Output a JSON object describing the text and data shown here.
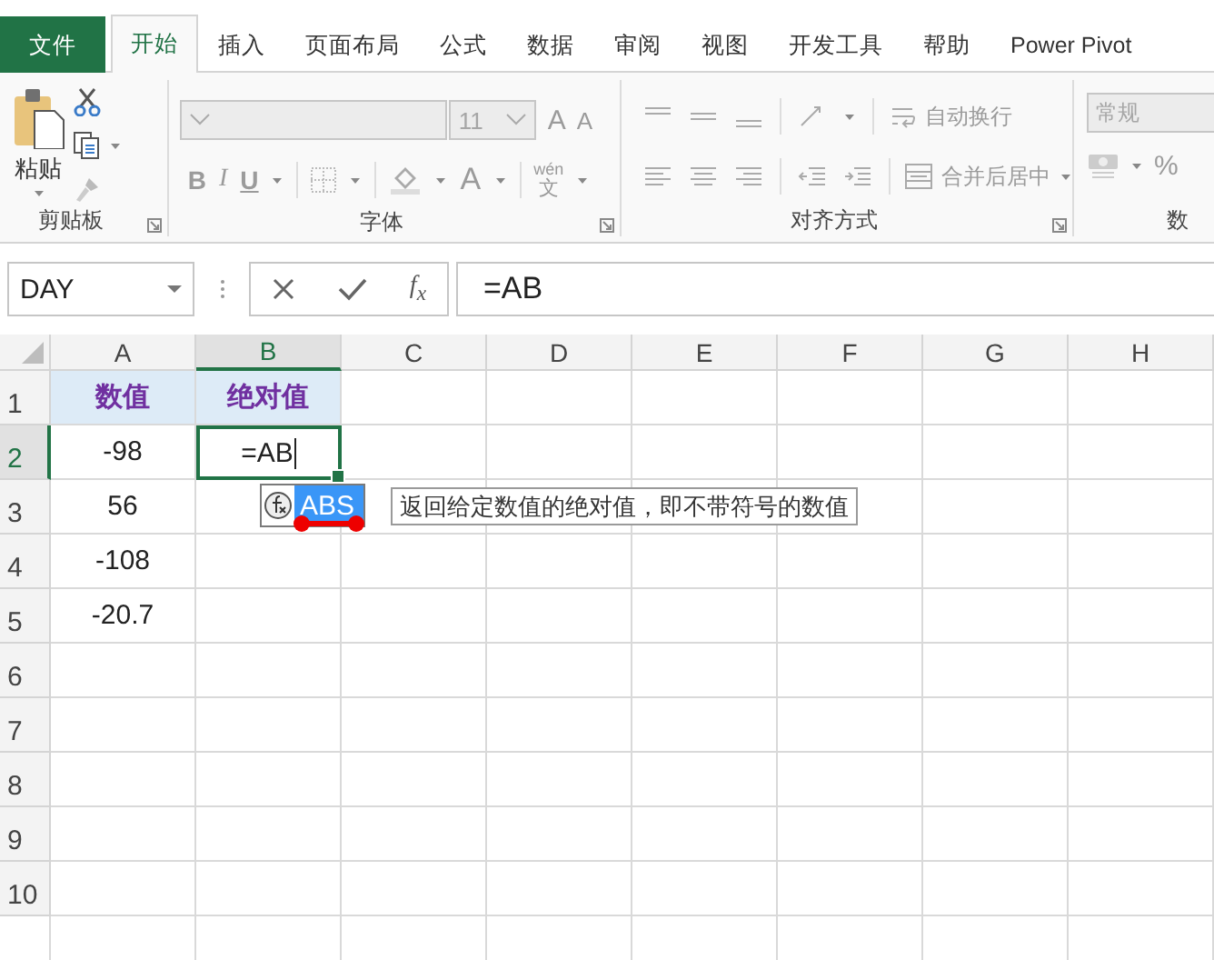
{
  "ribbon_tabs": [
    {
      "label": "文件",
      "kind": "file",
      "selected": false
    },
    {
      "label": "开始",
      "kind": "tab",
      "selected": true
    },
    {
      "label": "插入",
      "kind": "tab",
      "selected": false
    },
    {
      "label": "页面布局",
      "kind": "tab",
      "selected": false
    },
    {
      "label": "公式",
      "kind": "tab",
      "selected": false
    },
    {
      "label": "数据",
      "kind": "tab",
      "selected": false
    },
    {
      "label": "审阅",
      "kind": "tab",
      "selected": false
    },
    {
      "label": "视图",
      "kind": "tab",
      "selected": false
    },
    {
      "label": "开发工具",
      "kind": "tab",
      "selected": false
    },
    {
      "label": "帮助",
      "kind": "tab",
      "selected": false
    },
    {
      "label": "Power Pivot",
      "kind": "tab",
      "selected": false
    }
  ],
  "ribbon": {
    "clipboard": {
      "paste_label": "粘贴",
      "group_label": "剪贴板"
    },
    "font": {
      "font_size": "11",
      "grow_label": "A",
      "shrink_label": "A",
      "bold_label": "B",
      "italic_label": "I",
      "underline_label": "U",
      "font_color_label": "A",
      "phonetic_top": "wén",
      "phonetic_bottom": "文",
      "group_label": "字体"
    },
    "alignment": {
      "wrap_text": "自动换行",
      "merge_center": "合并后居中",
      "group_label": "对齐方式"
    },
    "number": {
      "format": "常规",
      "percent": "%",
      "group_label": "数"
    }
  },
  "formula_bar": {
    "name_box": "DAY",
    "function_label": "f$_{x}$",
    "formula": "=AB"
  },
  "sheet": {
    "columns": [
      {
        "label": "A",
        "selected": false
      },
      {
        "label": "B",
        "selected": true
      },
      {
        "label": "C",
        "selected": false
      },
      {
        "label": "D",
        "selected": false
      },
      {
        "label": "E",
        "selected": false
      },
      {
        "label": "F",
        "selected": false
      },
      {
        "label": "G",
        "selected": false
      },
      {
        "label": "H",
        "selected": false
      }
    ],
    "rows": [
      {
        "label": "1",
        "selected": false,
        "kind": "header",
        "cells": [
          {
            "text": "数值",
            "editing": false
          },
          {
            "text": "绝对值",
            "editing": false
          }
        ]
      },
      {
        "label": "2",
        "selected": true,
        "kind": "data",
        "cells": [
          {
            "text": "-98",
            "editing": false
          },
          {
            "text": "=AB",
            "editing": true
          }
        ]
      },
      {
        "label": "3",
        "selected": false,
        "kind": "data",
        "cells": [
          {
            "text": "56",
            "editing": false
          }
        ]
      },
      {
        "label": "4",
        "selected": false,
        "kind": "data",
        "cells": [
          {
            "text": "-108",
            "editing": false
          }
        ]
      },
      {
        "label": "5",
        "selected": false,
        "kind": "data",
        "cells": [
          {
            "text": "-20.7",
            "editing": false
          }
        ]
      },
      {
        "label": "6",
        "selected": false,
        "kind": "data",
        "cells": []
      },
      {
        "label": "7",
        "selected": false,
        "kind": "data",
        "cells": []
      },
      {
        "label": "8",
        "selected": false,
        "kind": "data",
        "cells": []
      },
      {
        "label": "9",
        "selected": false,
        "kind": "data",
        "cells": []
      },
      {
        "label": "10",
        "selected": false,
        "kind": "data",
        "cells": []
      }
    ],
    "autocomplete": {
      "items": [
        {
          "label": "ABS",
          "selected": true
        }
      ],
      "tooltip": "返回给定数值的绝对值，即不带符号的数值"
    }
  }
}
